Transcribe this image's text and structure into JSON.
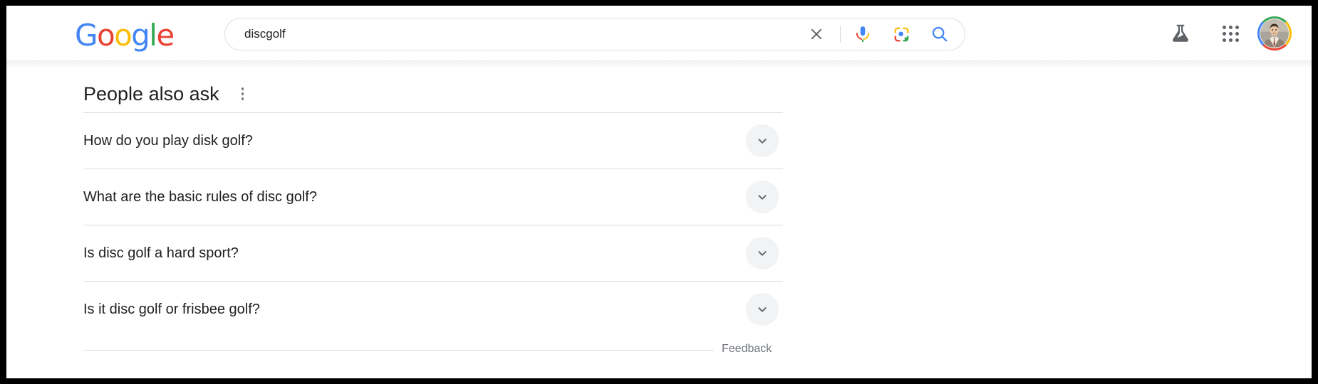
{
  "window": {
    "border_color": "#000000",
    "background": "#ffffff"
  },
  "header": {
    "logo": {
      "name": "Google",
      "letters": [
        {
          "char": "G",
          "color": "#4285f4"
        },
        {
          "char": "o",
          "color": "#ea4335"
        },
        {
          "char": "o",
          "color": "#fbbc05"
        },
        {
          "char": "g",
          "color": "#4285f4"
        },
        {
          "char": "l",
          "color": "#34a853"
        },
        {
          "char": "e",
          "color": "#ea4335"
        }
      ]
    },
    "search": {
      "value": "discgolf",
      "placeholder": "Search",
      "clear_label": "Clear",
      "voice_label": "Search by voice",
      "lens_label": "Search by image",
      "submit_label": "Google Search"
    },
    "right_icons": [
      {
        "name": "labs-icon",
        "label": "Search Labs",
        "color": "#5f6368"
      },
      {
        "name": "apps-grid-icon",
        "label": "Google apps",
        "color": "#5f6368"
      },
      {
        "name": "avatar",
        "label": "Google Account"
      }
    ]
  },
  "main": {
    "people_also_ask": {
      "title": "People also ask",
      "menu_label": "About this result",
      "questions": [
        {
          "text": "How do you play disk golf?",
          "expanded": false
        },
        {
          "text": "What are the basic rules of disc golf?",
          "expanded": false
        },
        {
          "text": "Is disc golf a hard sport?",
          "expanded": false
        },
        {
          "text": "Is it disc golf or frisbee golf?",
          "expanded": false
        }
      ],
      "feedback_label": "Feedback"
    }
  },
  "colors": {
    "google_blue": "#4285f4",
    "google_red": "#ea4335",
    "google_yellow": "#fbbc05",
    "google_green": "#34a853",
    "text_primary": "#202124",
    "text_secondary": "#70757a",
    "divider": "#dadce0",
    "chip_bg": "#f1f3f4"
  }
}
